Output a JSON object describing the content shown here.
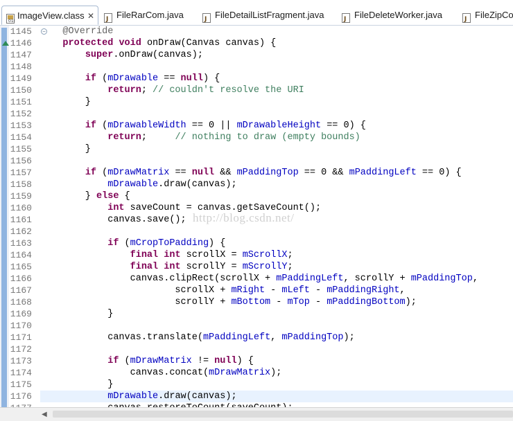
{
  "tabs": [
    {
      "label": "ImageView.class",
      "close": "✕",
      "active": true,
      "icon": "class-file-icon"
    },
    {
      "label": "FileRarCom.java",
      "active": false,
      "icon": "java-file-icon"
    },
    {
      "label": "FileDetailListFragment.java",
      "active": false,
      "icon": "java-file-icon"
    },
    {
      "label": "FileDeleteWorker.java",
      "active": false,
      "icon": "java-file-icon"
    },
    {
      "label": "FileZipCom",
      "active": false,
      "icon": "java-file-icon"
    }
  ],
  "editor": {
    "current_line": 1176,
    "watermark": "http://blog.csdn.net/",
    "lines": [
      {
        "n": "1145",
        "t": [
          [
            "an",
            "    @Override"
          ]
        ]
      },
      {
        "n": "1146",
        "t": [
          [
            "p",
            "    "
          ],
          [
            "kw",
            "protected"
          ],
          [
            "p",
            " "
          ],
          [
            "kw",
            "void"
          ],
          [
            "p",
            " onDraw(Canvas canvas) {"
          ]
        ]
      },
      {
        "n": "1147",
        "t": [
          [
            "p",
            "        "
          ],
          [
            "kw",
            "super"
          ],
          [
            "p",
            ".onDraw(canvas);"
          ]
        ]
      },
      {
        "n": "1148",
        "t": []
      },
      {
        "n": "1149",
        "t": [
          [
            "p",
            "        "
          ],
          [
            "kw",
            "if"
          ],
          [
            "p",
            " ("
          ],
          [
            "fd",
            "mDrawable"
          ],
          [
            "p",
            " == "
          ],
          [
            "kw",
            "null"
          ],
          [
            "p",
            ") {"
          ]
        ]
      },
      {
        "n": "1150",
        "t": [
          [
            "p",
            "            "
          ],
          [
            "kw",
            "return"
          ],
          [
            "p",
            "; "
          ],
          [
            "cm",
            "// couldn't resolve the URI"
          ]
        ]
      },
      {
        "n": "1151",
        "t": [
          [
            "p",
            "        }"
          ]
        ]
      },
      {
        "n": "1152",
        "t": []
      },
      {
        "n": "1153",
        "t": [
          [
            "p",
            "        "
          ],
          [
            "kw",
            "if"
          ],
          [
            "p",
            " ("
          ],
          [
            "fd",
            "mDrawableWidth"
          ],
          [
            "p",
            " == 0 || "
          ],
          [
            "fd",
            "mDrawableHeight"
          ],
          [
            "p",
            " == 0) {"
          ]
        ]
      },
      {
        "n": "1154",
        "t": [
          [
            "p",
            "            "
          ],
          [
            "kw",
            "return"
          ],
          [
            "p",
            ";     "
          ],
          [
            "cm",
            "// nothing to draw (empty bounds)"
          ]
        ]
      },
      {
        "n": "1155",
        "t": [
          [
            "p",
            "        }"
          ]
        ]
      },
      {
        "n": "1156",
        "t": []
      },
      {
        "n": "1157",
        "t": [
          [
            "p",
            "        "
          ],
          [
            "kw",
            "if"
          ],
          [
            "p",
            " ("
          ],
          [
            "fd",
            "mDrawMatrix"
          ],
          [
            "p",
            " == "
          ],
          [
            "kw",
            "null"
          ],
          [
            "p",
            " && "
          ],
          [
            "fd",
            "mPaddingTop"
          ],
          [
            "p",
            " == 0 && "
          ],
          [
            "fd",
            "mPaddingLeft"
          ],
          [
            "p",
            " == 0) {"
          ]
        ]
      },
      {
        "n": "1158",
        "t": [
          [
            "p",
            "            "
          ],
          [
            "fd",
            "mDrawable"
          ],
          [
            "p",
            ".draw(canvas);"
          ]
        ]
      },
      {
        "n": "1159",
        "t": [
          [
            "p",
            "        } "
          ],
          [
            "kw",
            "else"
          ],
          [
            "p",
            " {"
          ]
        ]
      },
      {
        "n": "1160",
        "t": [
          [
            "p",
            "            "
          ],
          [
            "kw",
            "int"
          ],
          [
            "p",
            " saveCount = canvas.getSaveCount();"
          ]
        ]
      },
      {
        "n": "1161",
        "t": [
          [
            "p",
            "            canvas.save();"
          ]
        ]
      },
      {
        "n": "1162",
        "t": []
      },
      {
        "n": "1163",
        "t": [
          [
            "p",
            "            "
          ],
          [
            "kw",
            "if"
          ],
          [
            "p",
            " ("
          ],
          [
            "fd",
            "mCropToPadding"
          ],
          [
            "p",
            ") {"
          ]
        ]
      },
      {
        "n": "1164",
        "t": [
          [
            "p",
            "                "
          ],
          [
            "kw",
            "final"
          ],
          [
            "p",
            " "
          ],
          [
            "kw",
            "int"
          ],
          [
            "p",
            " scrollX = "
          ],
          [
            "fd",
            "mScrollX"
          ],
          [
            "p",
            ";"
          ]
        ]
      },
      {
        "n": "1165",
        "t": [
          [
            "p",
            "                "
          ],
          [
            "kw",
            "final"
          ],
          [
            "p",
            " "
          ],
          [
            "kw",
            "int"
          ],
          [
            "p",
            " scrollY = "
          ],
          [
            "fd",
            "mScrollY"
          ],
          [
            "p",
            ";"
          ]
        ]
      },
      {
        "n": "1166",
        "t": [
          [
            "p",
            "                canvas.clipRect(scrollX + "
          ],
          [
            "fd",
            "mPaddingLeft"
          ],
          [
            "p",
            ", scrollY + "
          ],
          [
            "fd",
            "mPaddingTop"
          ],
          [
            "p",
            ","
          ]
        ]
      },
      {
        "n": "1167",
        "t": [
          [
            "p",
            "                        scrollX + "
          ],
          [
            "fd",
            "mRight"
          ],
          [
            "p",
            " - "
          ],
          [
            "fd",
            "mLeft"
          ],
          [
            "p",
            " - "
          ],
          [
            "fd",
            "mPaddingRight"
          ],
          [
            "p",
            ","
          ]
        ]
      },
      {
        "n": "1168",
        "t": [
          [
            "p",
            "                        scrollY + "
          ],
          [
            "fd",
            "mBottom"
          ],
          [
            "p",
            " - "
          ],
          [
            "fd",
            "mTop"
          ],
          [
            "p",
            " - "
          ],
          [
            "fd",
            "mPaddingBottom"
          ],
          [
            "p",
            ");"
          ]
        ]
      },
      {
        "n": "1169",
        "t": [
          [
            "p",
            "            }"
          ]
        ]
      },
      {
        "n": "1170",
        "t": []
      },
      {
        "n": "1171",
        "t": [
          [
            "p",
            "            canvas.translate("
          ],
          [
            "fd",
            "mPaddingLeft"
          ],
          [
            "p",
            ", "
          ],
          [
            "fd",
            "mPaddingTop"
          ],
          [
            "p",
            ");"
          ]
        ]
      },
      {
        "n": "1172",
        "t": []
      },
      {
        "n": "1173",
        "t": [
          [
            "p",
            "            "
          ],
          [
            "kw",
            "if"
          ],
          [
            "p",
            " ("
          ],
          [
            "fd",
            "mDrawMatrix"
          ],
          [
            "p",
            " != "
          ],
          [
            "kw",
            "null"
          ],
          [
            "p",
            ") {"
          ]
        ]
      },
      {
        "n": "1174",
        "t": [
          [
            "p",
            "                canvas.concat("
          ],
          [
            "fd",
            "mDrawMatrix"
          ],
          [
            "p",
            ");"
          ]
        ]
      },
      {
        "n": "1175",
        "t": [
          [
            "p",
            "            }"
          ]
        ]
      },
      {
        "n": "1176",
        "t": [
          [
            "p",
            "            "
          ],
          [
            "fd",
            "mDrawable"
          ],
          [
            "p",
            ".draw(canvas);"
          ]
        ]
      },
      {
        "n": "1177",
        "t": [
          [
            "p",
            "            canvas.restoreToCount(saveCount);"
          ]
        ]
      }
    ]
  }
}
